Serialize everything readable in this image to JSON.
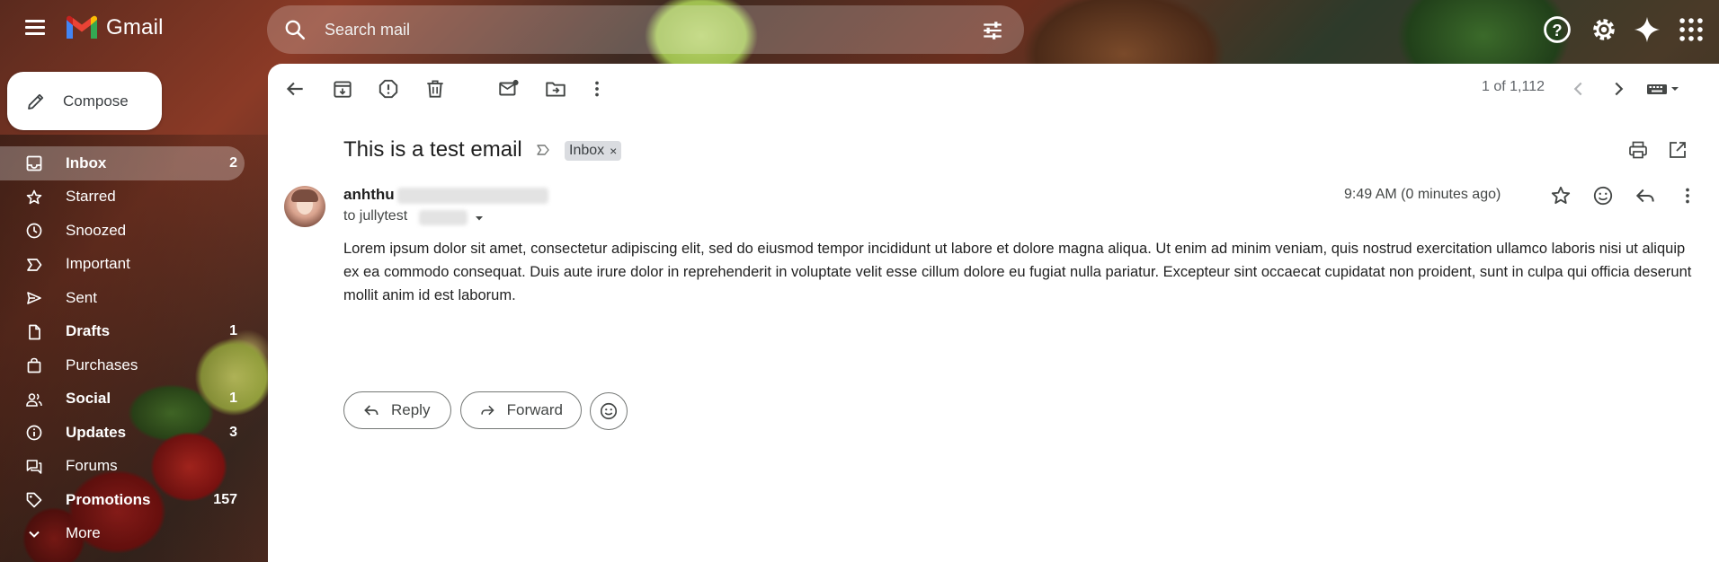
{
  "app": {
    "name": "Gmail"
  },
  "search": {
    "placeholder": "Search mail"
  },
  "compose": {
    "label": "Compose"
  },
  "nav": [
    {
      "label": "Inbox",
      "count": "2",
      "icon": "inbox-icon",
      "active": true,
      "bold": true
    },
    {
      "label": "Starred",
      "count": "",
      "icon": "star-icon"
    },
    {
      "label": "Snoozed",
      "count": "",
      "icon": "clock-icon"
    },
    {
      "label": "Important",
      "count": "",
      "icon": "label-important-icon"
    },
    {
      "label": "Sent",
      "count": "",
      "icon": "send-icon"
    },
    {
      "label": "Drafts",
      "count": "1",
      "icon": "draft-icon",
      "bold": true
    },
    {
      "label": "Purchases",
      "count": "",
      "icon": "shopping-bag-icon"
    },
    {
      "label": "Social",
      "count": "1",
      "icon": "people-icon",
      "bold": true
    },
    {
      "label": "Updates",
      "count": "3",
      "icon": "info-icon",
      "bold": true
    },
    {
      "label": "Forums",
      "count": "",
      "icon": "forum-icon"
    },
    {
      "label": "Promotions",
      "count": "157",
      "icon": "tag-icon",
      "bold": true
    },
    {
      "label": "More",
      "count": "",
      "icon": "chevron-down-icon"
    }
  ],
  "toolbar": {
    "pager": "1 of 1,112"
  },
  "email": {
    "subject": "This is a test email",
    "label_chip": "Inbox",
    "label_chip_close": "×",
    "sender_name": "anhthu",
    "to_prefix": "to jullytest",
    "time": "9:49 AM (0 minutes ago)",
    "body": "Lorem ipsum dolor sit amet, consectetur adipiscing elit, sed do eiusmod tempor incididunt ut labore et dolore magna aliqua. Ut enim ad minim veniam, quis nostrud exercitation ullamco laboris nisi ut aliquip ex ea commodo consequat. Duis aute irure dolor in reprehenderit in voluptate velit esse cillum dolore eu fugiat nulla pariatur. Excepteur sint occaecat cupidatat non proident, sunt in culpa qui officia deserunt mollit anim id est laborum."
  },
  "actions": {
    "reply": "Reply",
    "forward": "Forward"
  },
  "colors": {
    "gmail_red": "#ea4335",
    "gmail_blue": "#4285f4",
    "gmail_green": "#34a853",
    "gmail_yellow": "#fbbc04"
  }
}
